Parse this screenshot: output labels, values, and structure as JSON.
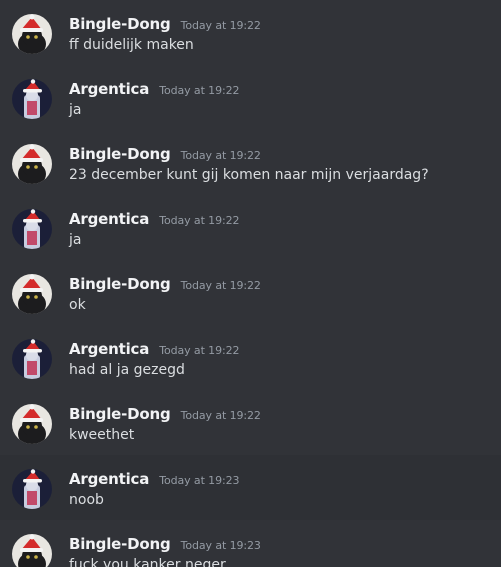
{
  "messages": [
    {
      "author": "Bingle-Dong",
      "avatar": "black-cat-santa-hat",
      "timestamp": "Today at 19:22",
      "text": "ff duidelijk maken"
    },
    {
      "author": "Argentica",
      "avatar": "cartoon-character-santa-hat",
      "timestamp": "Today at 19:22",
      "text": "ja"
    },
    {
      "author": "Bingle-Dong",
      "avatar": "black-cat-santa-hat",
      "timestamp": "Today at 19:22",
      "text": "23 december kunt gij komen naar mijn verjaardag?"
    },
    {
      "author": "Argentica",
      "avatar": "cartoon-character-santa-hat",
      "timestamp": "Today at 19:22",
      "text": "ja"
    },
    {
      "author": "Bingle-Dong",
      "avatar": "black-cat-santa-hat",
      "timestamp": "Today at 19:22",
      "text": "ok"
    },
    {
      "author": "Argentica",
      "avatar": "cartoon-character-santa-hat",
      "timestamp": "Today at 19:22",
      "text": "had al ja gezegd"
    },
    {
      "author": "Bingle-Dong",
      "avatar": "black-cat-santa-hat",
      "timestamp": "Today at 19:22",
      "text": "kweethet"
    },
    {
      "author": "Argentica",
      "avatar": "cartoon-character-santa-hat",
      "timestamp": "Today at 19:23",
      "text": "noob"
    },
    {
      "author": "Bingle-Dong",
      "avatar": "black-cat-santa-hat",
      "timestamp": "Today at 19:23",
      "text": "fuck you kanker neger"
    }
  ],
  "colors": {
    "background": "#313338",
    "hover_background": "#2e3035",
    "username": "#f2f3f5",
    "timestamp": "#949ba4",
    "message_text": "#dbdee1"
  }
}
